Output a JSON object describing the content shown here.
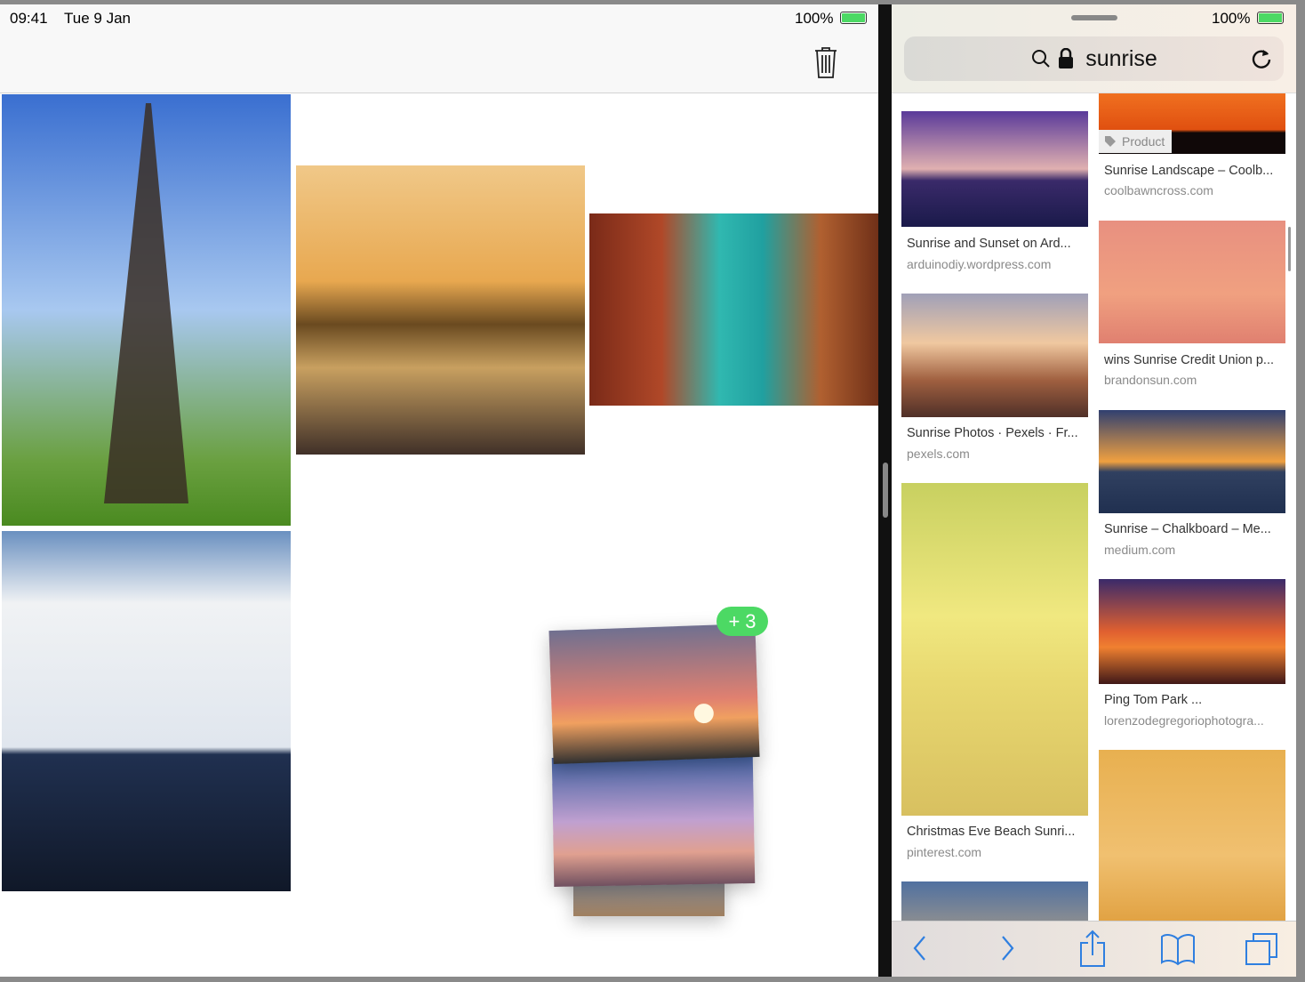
{
  "left": {
    "time": "09:41",
    "date": "Tue 9 Jan",
    "battery": "100%",
    "drag_count": "3"
  },
  "right": {
    "battery": "100%",
    "search_text": "sunrise",
    "tag": "Product",
    "results": [
      {
        "title": "Sunrise and Sunset on Ard...",
        "url": "arduinodiy.wordpress.com"
      },
      {
        "title": "Sunrise Photos · Pexels · Fr...",
        "url": "pexels.com"
      },
      {
        "title": "Christmas Eve Beach Sunri...",
        "url": "pinterest.com"
      },
      {
        "title": "Sunrise Landscape – Coolb...",
        "url": "coolbawncross.com"
      },
      {
        "title": "wins Sunrise Credit Union p...",
        "url": "brandonsun.com"
      },
      {
        "title": "Sunrise – Chalkboard – Me...",
        "url": "medium.com"
      },
      {
        "title": "Ping Tom Park ...",
        "url": "lorenzodegregoriophotogra..."
      }
    ]
  },
  "colors": {
    "accent": "#2f7fe0",
    "badge": "#4cd964",
    "battery": "#4cd964"
  }
}
